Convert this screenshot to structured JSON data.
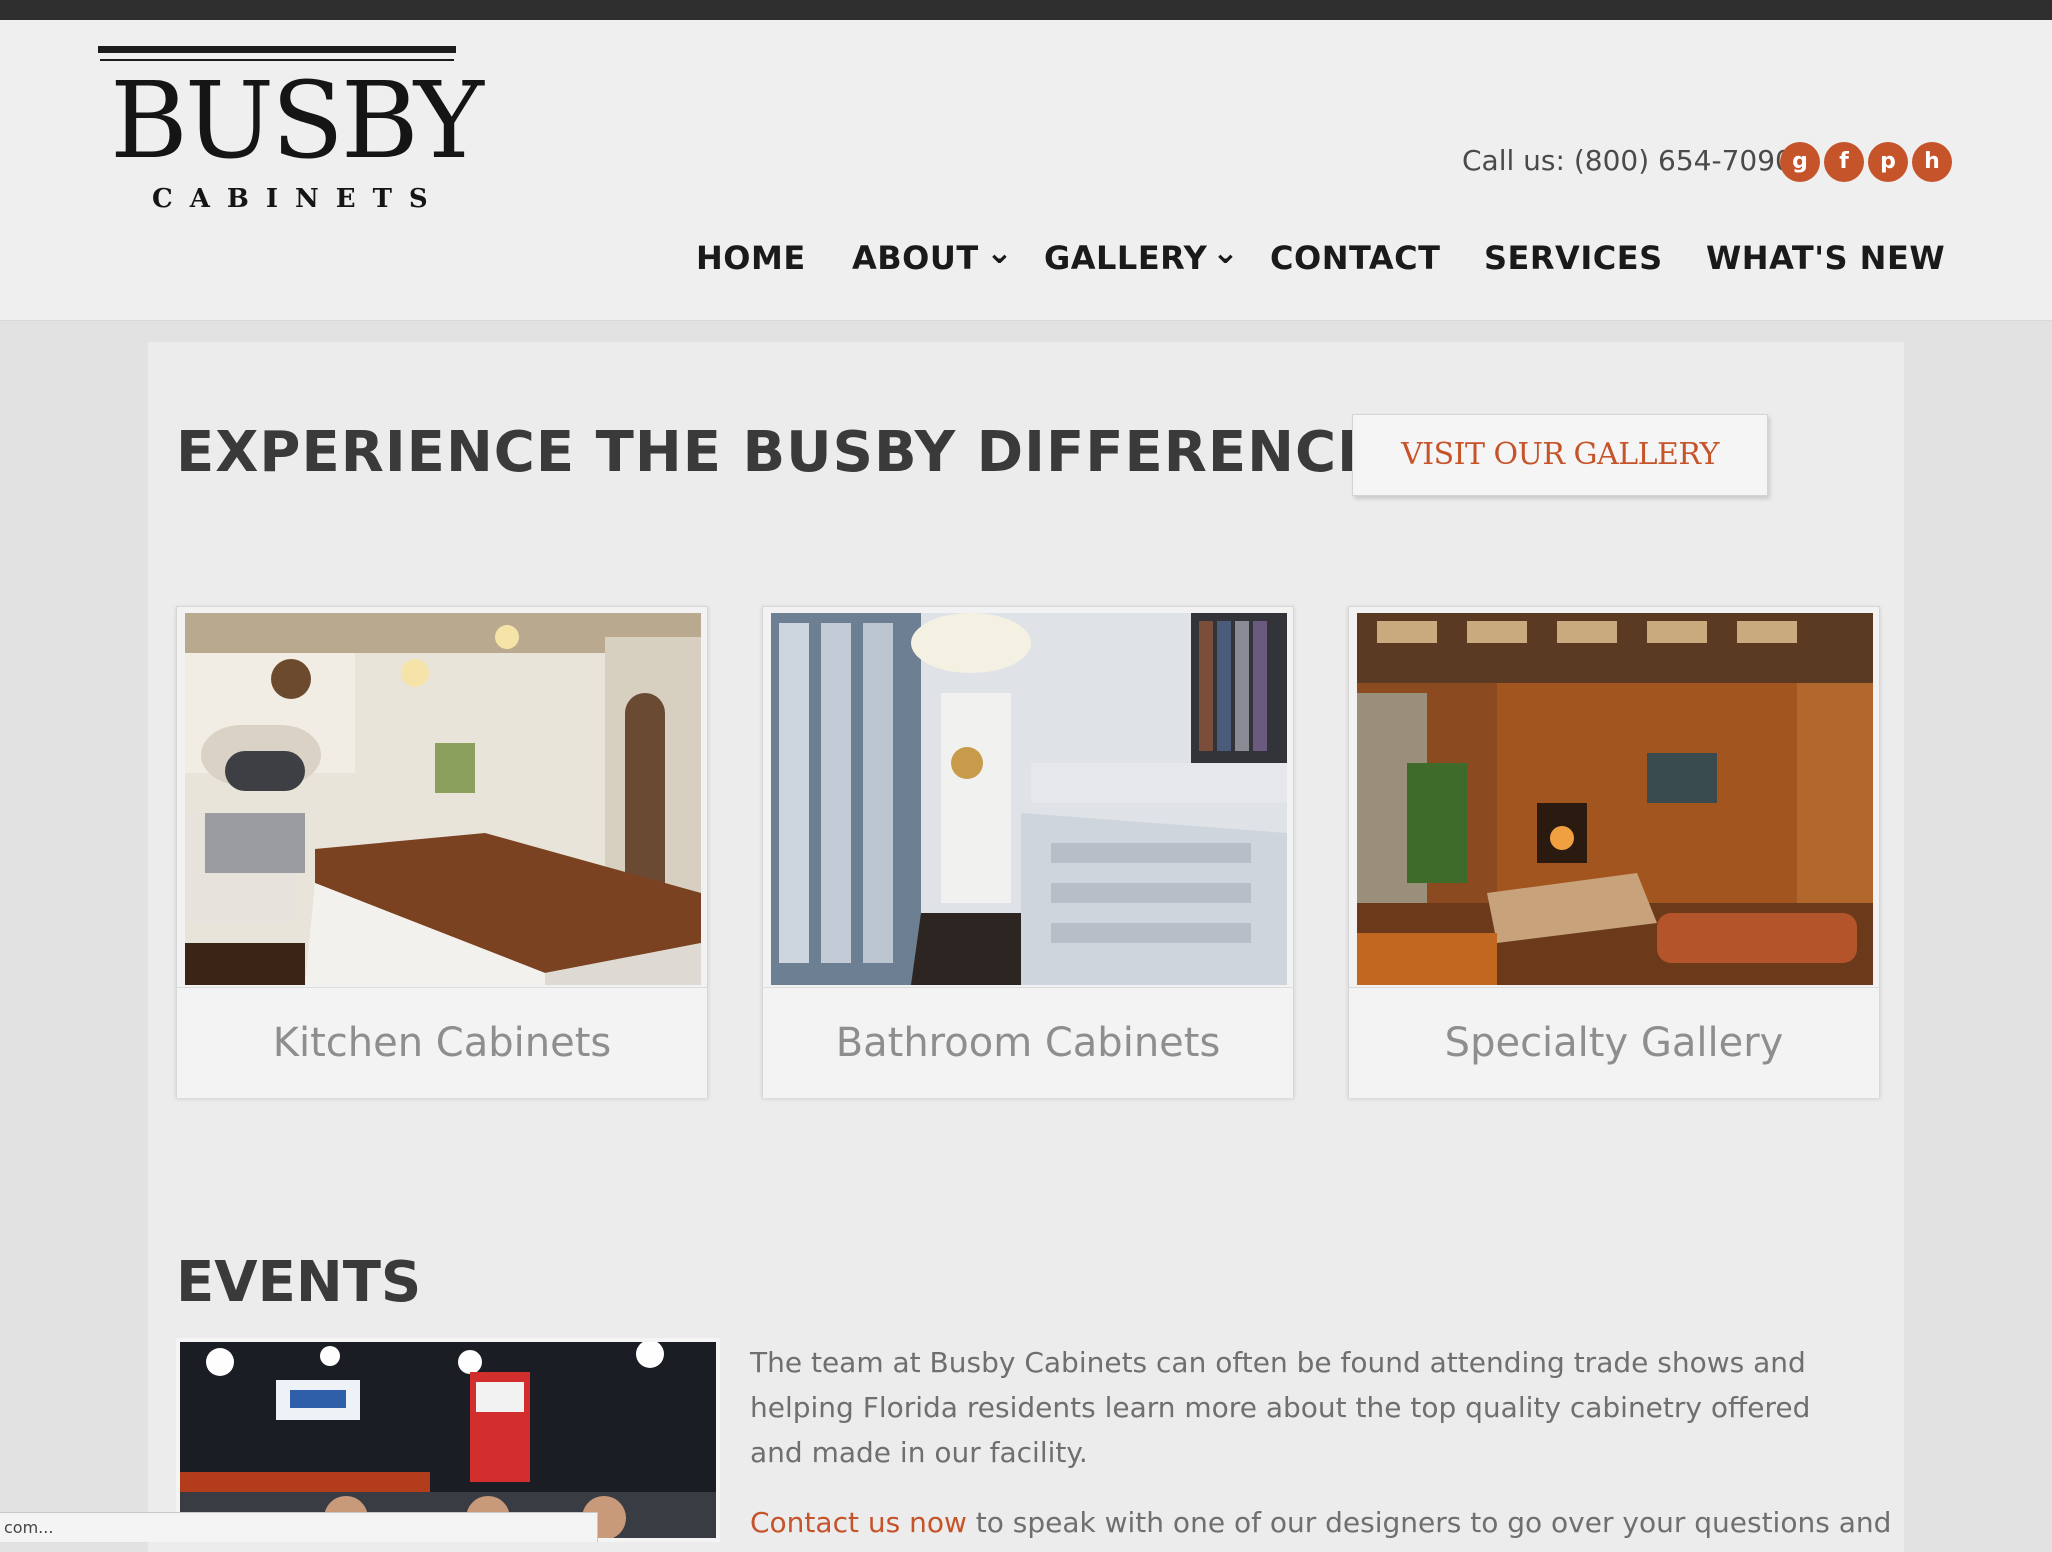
{
  "header": {
    "brand": "BUSBY",
    "brand_sub": "CABINETS",
    "phone": "Call us: (800) 654-7090",
    "social": [
      {
        "icon": "google-plus-icon",
        "glyph": "g"
      },
      {
        "icon": "facebook-icon",
        "glyph": "f"
      },
      {
        "icon": "pinterest-icon",
        "glyph": "p"
      },
      {
        "icon": "houzz-icon",
        "glyph": "h"
      }
    ],
    "nav": {
      "home": "HOME",
      "about": "ABOUT",
      "gallery": "GALLERY",
      "contact": "CONTACT",
      "services": "SERVICES",
      "whats_new": "WHAT'S NEW",
      "chevron": "⌄"
    }
  },
  "hero": {
    "headline": "EXPERIENCE THE BUSBY DIFFERENCE...",
    "gallery_button": "VISIT OUR GALLERY"
  },
  "cards": [
    {
      "caption": "Kitchen Cabinets"
    },
    {
      "caption": "Bathroom Cabinets"
    },
    {
      "caption": "Specialty Gallery"
    }
  ],
  "events": {
    "title": "EVENTS",
    "paragraph": "The team at Busby Cabinets can often be found attending trade shows and helping Florida residents learn more about the top quality cabinetry offered and made in our facility.",
    "contact_link": "Contact us now",
    "contact_rest": " to speak with one of our designers to go over your questions and"
  },
  "statusbar": {
    "text": "com..."
  },
  "colors": {
    "accent": "#c6542a",
    "heading": "#3a3a3a",
    "background": "#e2e2e2"
  }
}
